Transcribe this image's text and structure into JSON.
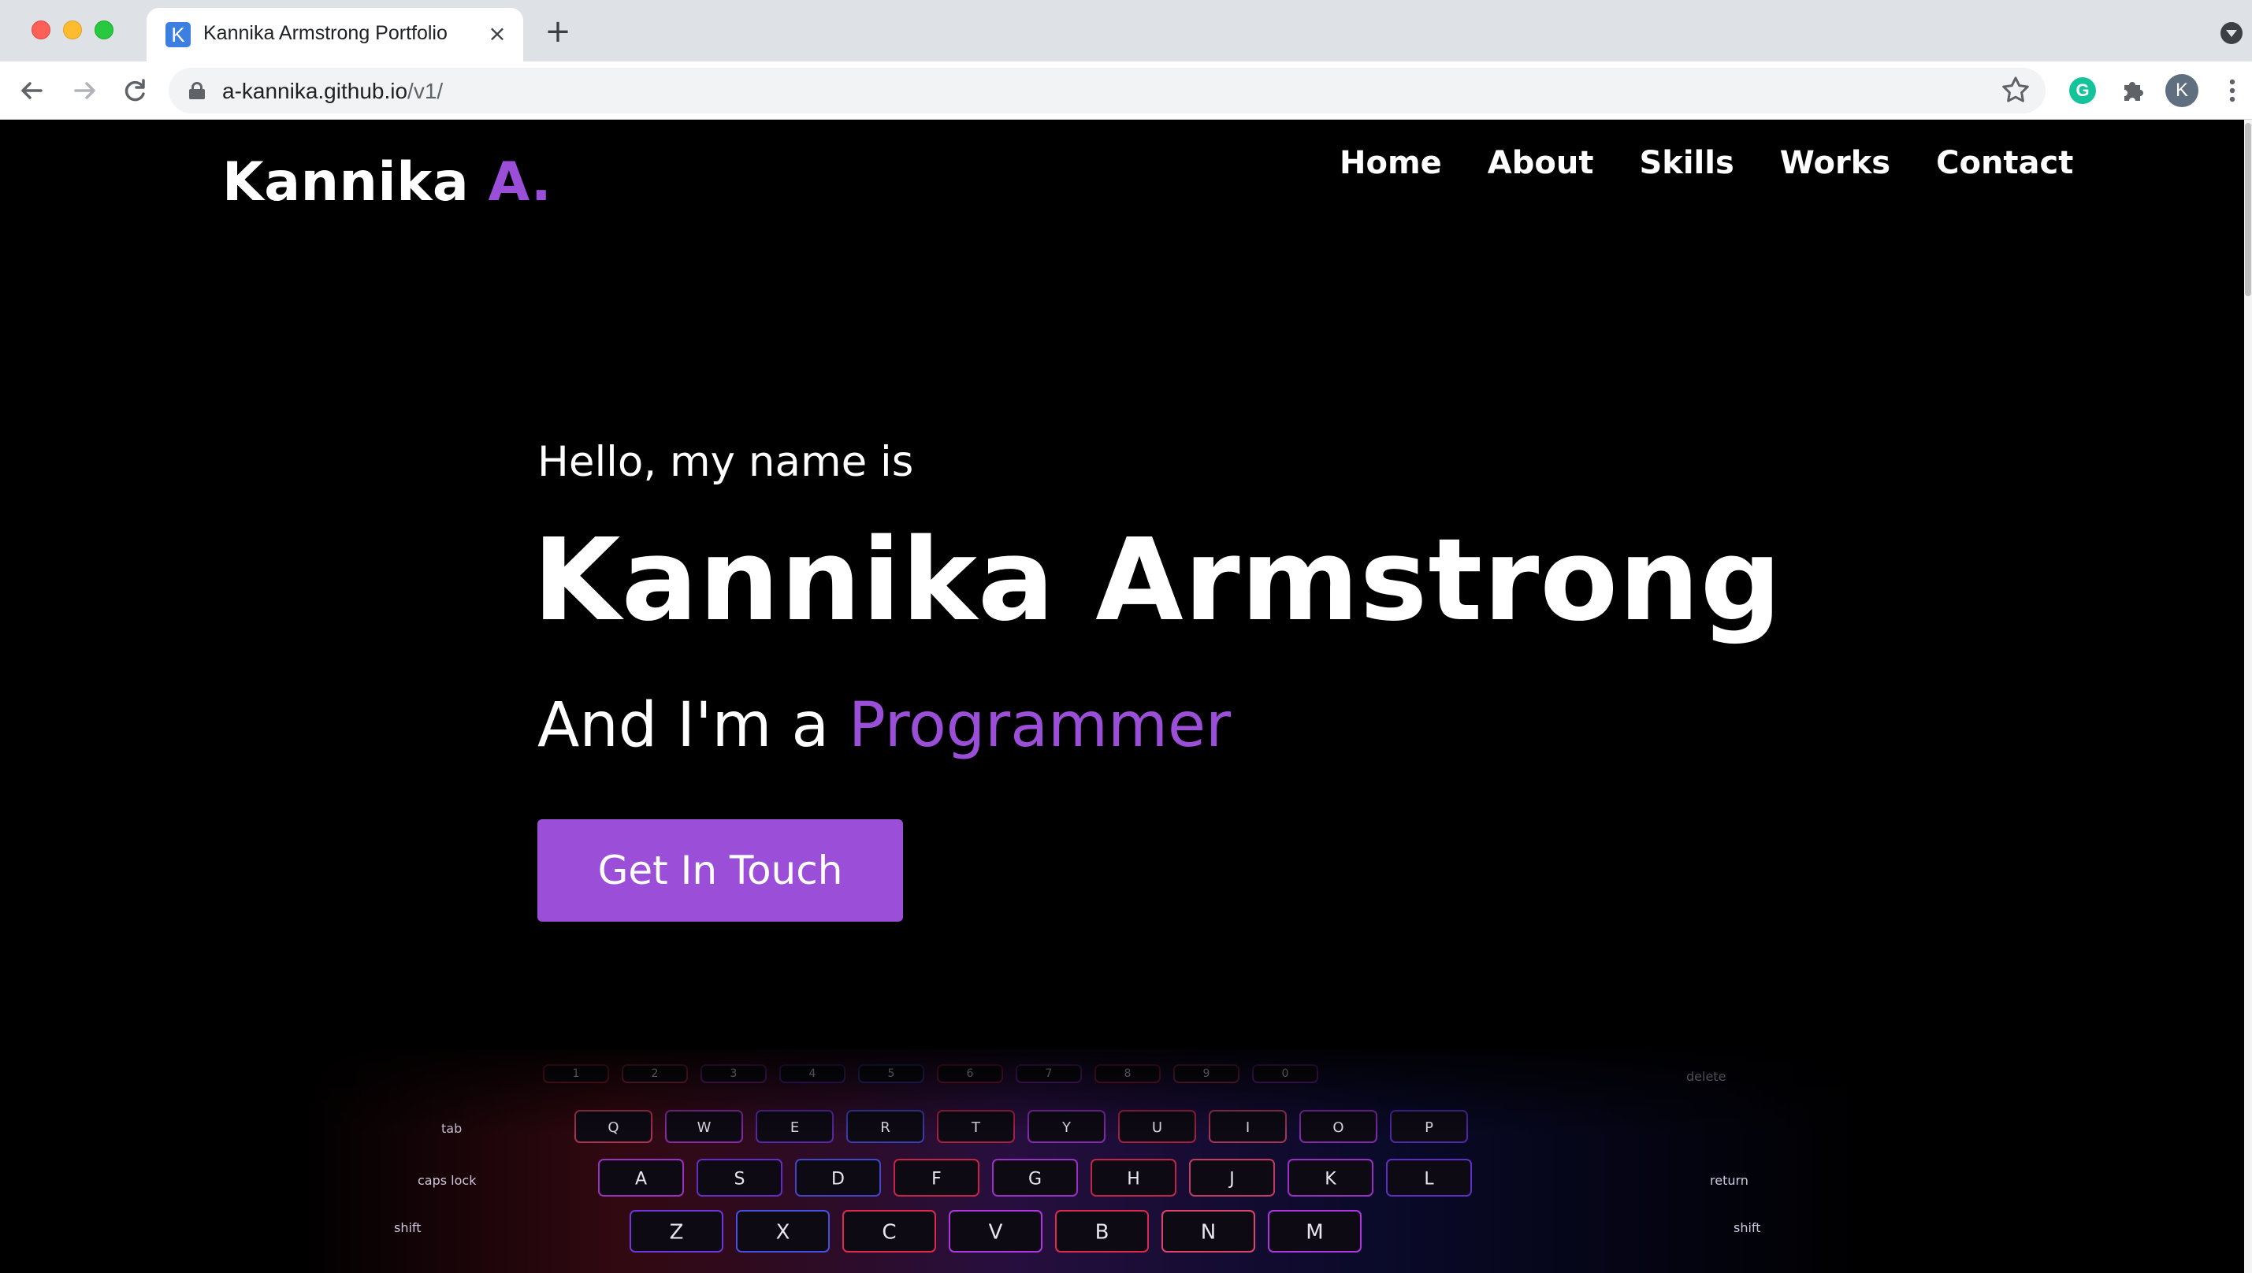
{
  "browser": {
    "tab_title": "Kannika Armstrong Portfolio",
    "tab_favicon_letter": "K",
    "tab_close_glyph": "×",
    "new_tab_glyph": "+",
    "url_host": "a-kannika.github.io",
    "url_path": "/v1/",
    "profile_initial": "K",
    "extensions": [
      "grammarly-icon",
      "puzzle-icon"
    ],
    "grammarly_letter": "G"
  },
  "site": {
    "logo_text": "Kannika ",
    "logo_accent": "A.",
    "nav": [
      {
        "label": "Home"
      },
      {
        "label": "About"
      },
      {
        "label": "Skills"
      },
      {
        "label": "Works"
      },
      {
        "label": "Contact"
      }
    ],
    "hero": {
      "greeting": "Hello, my name is",
      "name": "Kannika Armstrong",
      "role_prefix": "And I'm a ",
      "role": "Programmer",
      "cta_label": "Get In Touch"
    },
    "keyboard_rows": [
      [
        "1",
        "2",
        "3",
        "4",
        "5",
        "6",
        "7",
        "8",
        "9",
        "0"
      ],
      [
        "Q",
        "W",
        "E",
        "R",
        "T",
        "Y",
        "U",
        "I",
        "O",
        "P"
      ],
      [
        "A",
        "S",
        "D",
        "F",
        "G",
        "H",
        "J",
        "K",
        "L"
      ],
      [
        "Z",
        "X",
        "C",
        "V",
        "B",
        "N",
        "M"
      ]
    ],
    "keyboard_side_labels": [
      "tab",
      "caps lock",
      "shift",
      "delete",
      "return",
      "shift"
    ]
  },
  "colors": {
    "accent": "#9b4fd8",
    "background": "#000000",
    "text": "#ffffff"
  }
}
